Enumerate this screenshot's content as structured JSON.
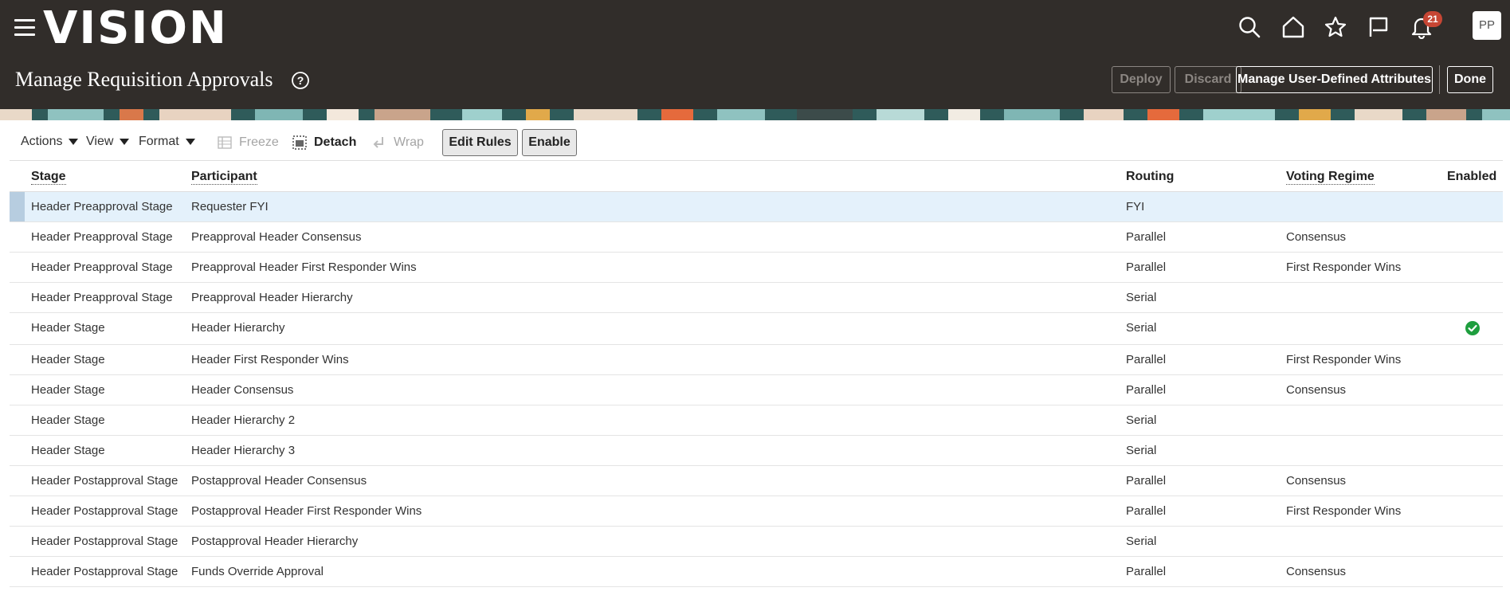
{
  "app": {
    "logo": "VISION",
    "notifications_count": "21",
    "avatar_initials": "PP",
    "icons": [
      "hamburger-icon",
      "search-icon",
      "home-icon",
      "star-icon",
      "flag-icon",
      "bell-icon",
      "help-icon",
      "check-circle-icon"
    ],
    "colors": {
      "header_bg": "#312d2a",
      "selected_row": "#e4f1fb",
      "badge": "#c74634",
      "enabled_check": "#1e9e3e"
    }
  },
  "page": {
    "title": "Manage Requisition Approvals",
    "buttons": {
      "deploy": "Deploy",
      "discard": "Discard",
      "manage_attrs": "Manage User-Defined Attributes",
      "done": "Done"
    }
  },
  "toolbar": {
    "actions": "Actions",
    "view": "View",
    "format": "Format",
    "freeze": "Freeze",
    "detach": "Detach",
    "wrap": "Wrap",
    "edit_rules": "Edit Rules",
    "enable": "Enable"
  },
  "table": {
    "columns": {
      "stage": "Stage",
      "participant": "Participant",
      "routing": "Routing",
      "voting_regime": "Voting Regime",
      "enabled": "Enabled"
    },
    "rows": [
      {
        "stage": "Header Preapproval Stage",
        "participant": "Requester FYI",
        "routing": "FYI",
        "voting": "",
        "enabled": false
      },
      {
        "stage": "Header Preapproval Stage",
        "participant": "Preapproval Header Consensus",
        "routing": "Parallel",
        "voting": "Consensus",
        "enabled": false
      },
      {
        "stage": "Header Preapproval Stage",
        "participant": "Preapproval Header First Responder Wins",
        "routing": "Parallel",
        "voting": "First Responder Wins",
        "enabled": false
      },
      {
        "stage": "Header Preapproval Stage",
        "participant": "Preapproval Header Hierarchy",
        "routing": "Serial",
        "voting": "",
        "enabled": false
      },
      {
        "stage": "Header Stage",
        "participant": "Header Hierarchy",
        "routing": "Serial",
        "voting": "",
        "enabled": true
      },
      {
        "stage": "Header Stage",
        "participant": "Header First Responder Wins",
        "routing": "Parallel",
        "voting": "First Responder Wins",
        "enabled": false
      },
      {
        "stage": "Header Stage",
        "participant": "Header Consensus",
        "routing": "Parallel",
        "voting": "Consensus",
        "enabled": false
      },
      {
        "stage": "Header Stage",
        "participant": "Header Hierarchy 2",
        "routing": "Serial",
        "voting": "",
        "enabled": false
      },
      {
        "stage": "Header Stage",
        "participant": "Header Hierarchy 3",
        "routing": "Serial",
        "voting": "",
        "enabled": false
      },
      {
        "stage": "Header Postapproval Stage",
        "participant": "Postapproval Header Consensus",
        "routing": "Parallel",
        "voting": "Consensus",
        "enabled": false
      },
      {
        "stage": "Header Postapproval Stage",
        "participant": "Postapproval Header First Responder Wins",
        "routing": "Parallel",
        "voting": "First Responder Wins",
        "enabled": false
      },
      {
        "stage": "Header Postapproval Stage",
        "participant": "Postapproval Header Hierarchy",
        "routing": "Serial",
        "voting": "",
        "enabled": false
      },
      {
        "stage": "Header Postapproval Stage",
        "participant": "Funds Override Approval",
        "routing": "Parallel",
        "voting": "Consensus",
        "enabled": false
      }
    ]
  }
}
